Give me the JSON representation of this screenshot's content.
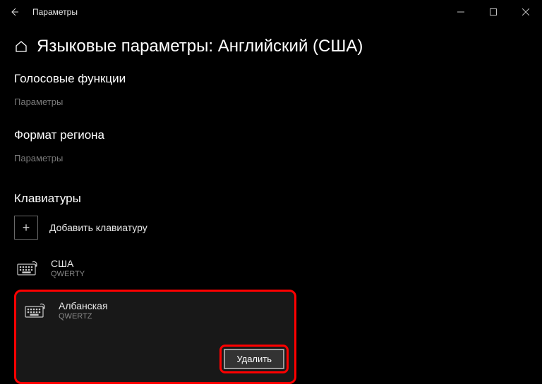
{
  "titlebar": {
    "app_title": "Параметры"
  },
  "header": {
    "page_title": "Языковые параметры: Английский (США)"
  },
  "sections": {
    "voice": {
      "heading": "Голосовые функции",
      "options_link": "Параметры"
    },
    "region": {
      "heading": "Формат региона",
      "options_link": "Параметры"
    },
    "keyboards": {
      "heading": "Клавиатуры",
      "add_label": "Добавить клавиатуру",
      "items": [
        {
          "name": "США",
          "layout": "QWERTY"
        },
        {
          "name": "Албанская",
          "layout": "QWERTZ"
        }
      ],
      "remove_label": "Удалить"
    }
  }
}
